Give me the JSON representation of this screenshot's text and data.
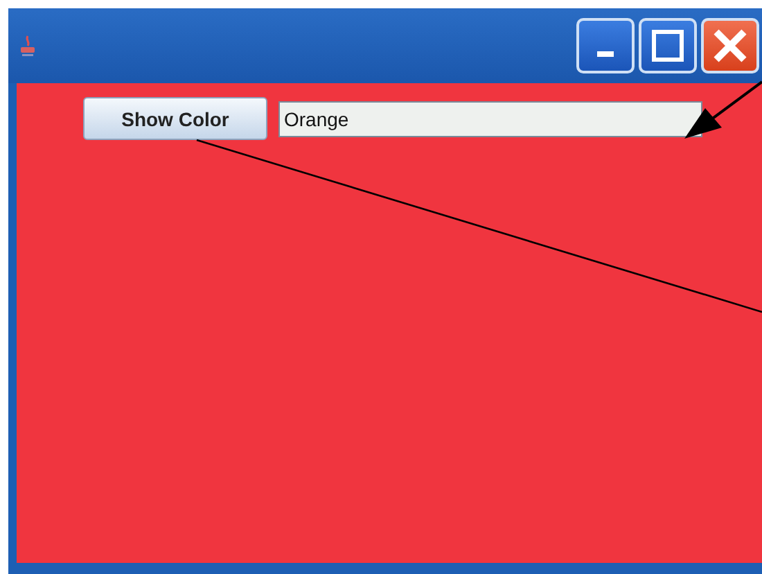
{
  "button": {
    "label": "Show Color"
  },
  "text_field": {
    "value": "Orange"
  }
}
